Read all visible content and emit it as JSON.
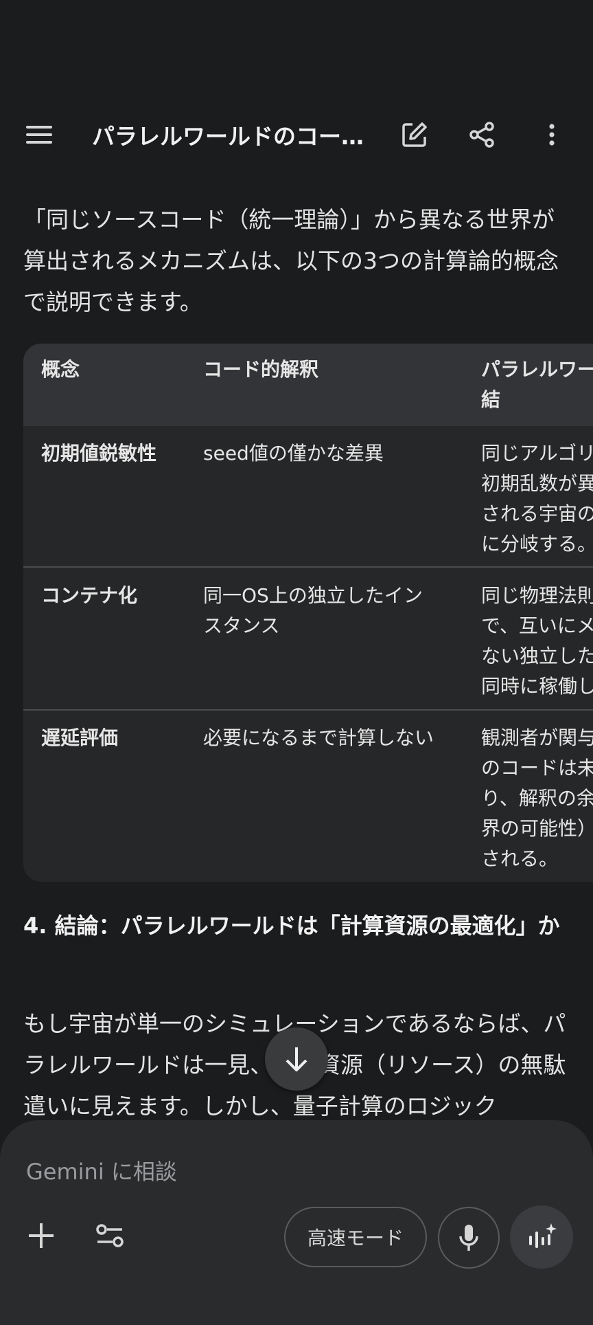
{
  "header": {
    "title": "パラレルワールドのコー…"
  },
  "intro_text": "「同じソースコード（統一理論）」から異なる世界が算出されるメカニズムは、以下の3つの計算論的概念で説明できます。",
  "table": {
    "headers": [
      "概念",
      "コード的解釈",
      "パラレルワー\n結"
    ],
    "rows": [
      {
        "concept": "初期値鋭敏性",
        "code": "seed値の僅かな差異",
        "result": "同じアルゴリ\n初期乱数が異\nされる宇宙の\nに分岐する。"
      },
      {
        "concept": "コンテナ化",
        "code": "同一OS上の独立したインスタンス",
        "result": "同じ物理法則\nで、互いにメ\nない独立した\n同時に稼働し"
      },
      {
        "concept": "遅延評価",
        "code": "必要になるまで計算しない",
        "result": "観測者が関与\nのコードは未\nり、解釈の余\n界の可能性）\nされる。"
      }
    ]
  },
  "section_heading": "4. 結論：パラレルワールドは「計算資源の最適化」か",
  "body_text": "もし宇宙が単一のシミュレーションであるならば、パラレルワールドは一見、計算資源（リソース）の無駄遣いに見えます。しかし、量子計算のロジック",
  "composer": {
    "placeholder": "Gemini に相談",
    "mode_label": "高速モード"
  },
  "icons": {
    "menu": "menu-icon",
    "edit": "edit-icon",
    "share": "share-icon",
    "more": "more-vert-icon",
    "scroll": "arrow-down-icon",
    "add": "plus-icon",
    "tools": "tools-icon",
    "mic": "mic-icon",
    "live": "live-icon"
  },
  "colors": {
    "background": "#1b1c1e",
    "table_header": "#333437",
    "table_body": "#262728",
    "composer": "#2a2b2d"
  }
}
